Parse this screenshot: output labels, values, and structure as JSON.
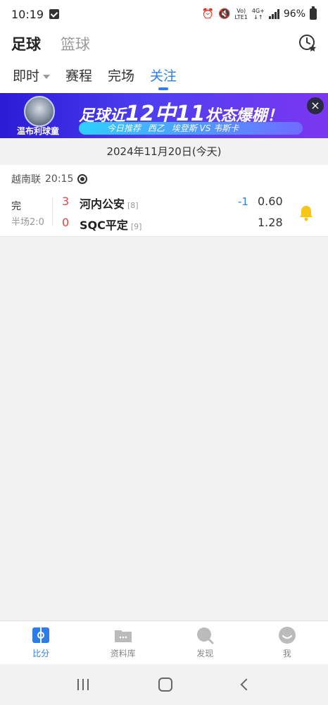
{
  "status_bar": {
    "time": "10:19",
    "network_top": "Vo)",
    "network_bottom": "LTE1",
    "net_type": "4G+",
    "battery": "96%"
  },
  "header": {
    "sports": [
      "足球",
      "篮球"
    ],
    "active_sport": "足球"
  },
  "tabs": [
    {
      "label": "即时"
    },
    {
      "label": "赛程"
    },
    {
      "label": "完场"
    },
    {
      "label": "关注"
    }
  ],
  "banner": {
    "logo_label": "温布利球童",
    "headline_pre": "足球近",
    "headline_num": "12中11",
    "headline_post": "状态爆棚！",
    "sub_tag": "今日推荐",
    "sub_league": "西乙",
    "sub_match": "埃登斯 VS 韦斯卡",
    "close": "×"
  },
  "date": "2024年11月20日(今天)",
  "match": {
    "league": "越南联",
    "time": "20:15",
    "status": "完",
    "half": "半场2:0",
    "home": {
      "score": "3",
      "name": "河内公安",
      "rank": "[8]",
      "handicap": "-1",
      "odds": "0.60"
    },
    "away": {
      "score": "0",
      "name": "SQC平定",
      "rank": "[9]",
      "odds": "1.28"
    }
  },
  "bottom_nav": [
    {
      "label": "比分",
      "icon": "scoreboard-icon"
    },
    {
      "label": "资料库",
      "icon": "folder-icon"
    },
    {
      "label": "发现",
      "icon": "discover-icon"
    },
    {
      "label": "我",
      "icon": "profile-icon"
    }
  ],
  "colors": {
    "accent": "#2b7de9",
    "score_red": "#e04545",
    "bell": "#f5c518"
  }
}
